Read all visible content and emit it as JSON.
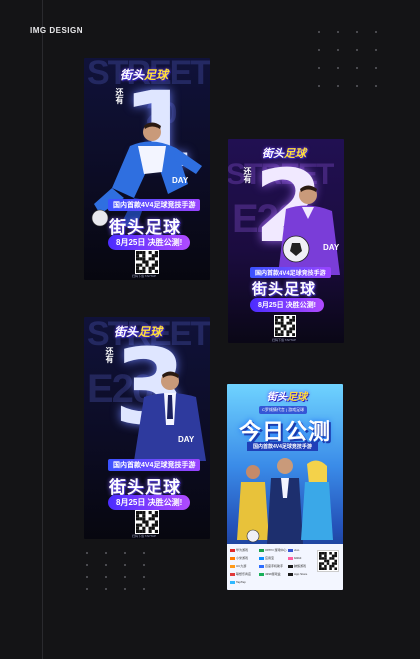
{
  "header": {
    "title": "IMG DESIGN"
  },
  "posters": {
    "p1": {
      "bg_letters": "STREET\n2020",
      "logo_a": "街头",
      "logo_b": "足球",
      "count_prefix": "还有",
      "number": "1",
      "day": "DAY",
      "tagline": "国内首款4V4足球竞技手游",
      "title": "街头足球",
      "date": "8月25日 决胜公测!",
      "fine": "扫码下载    TAPTAP"
    },
    "p2": {
      "bg_letters": "STREET\n2020",
      "logo_a": "街头",
      "logo_b": "足球",
      "count_prefix": "还有",
      "number": "2",
      "day": "DAY",
      "tagline": "国内首款4V4足球竞技手游",
      "title": "街头足球",
      "date": "8月25日 决胜公测!",
      "fine": "扫码下载 TAPTAP"
    },
    "p3": {
      "bg_letters": "STREET\n2020",
      "logo_a": "街头",
      "logo_b": "足球",
      "count_prefix": "还有",
      "number": "3",
      "day": "DAY",
      "tagline": "国内首款4V4足球竞技手游",
      "title": "街头足球",
      "date": "8月25日 决胜公测!",
      "fine": "扫码下载 TAPTAP"
    },
    "p4": {
      "logo_a": "街头",
      "logo_b": "足球",
      "badge": "C罗倾情代言 | 游戏足球",
      "headline": "今日公测",
      "strip": "国内首款4V4足球竞技手游",
      "stores": [
        "华为游戏",
        "OPPO 游戏中心",
        "vivo",
        "小米游戏",
        "应用宝",
        "bilibili",
        "UC九游",
        "百度手机助手",
        "魅族游戏",
        "联想乐商店",
        "4399游戏盒",
        "App Store",
        "TapTap"
      ]
    }
  },
  "colors": {
    "background": "#141416",
    "accent_blue": "#3a52ff",
    "accent_violet": "#9a43ff"
  }
}
